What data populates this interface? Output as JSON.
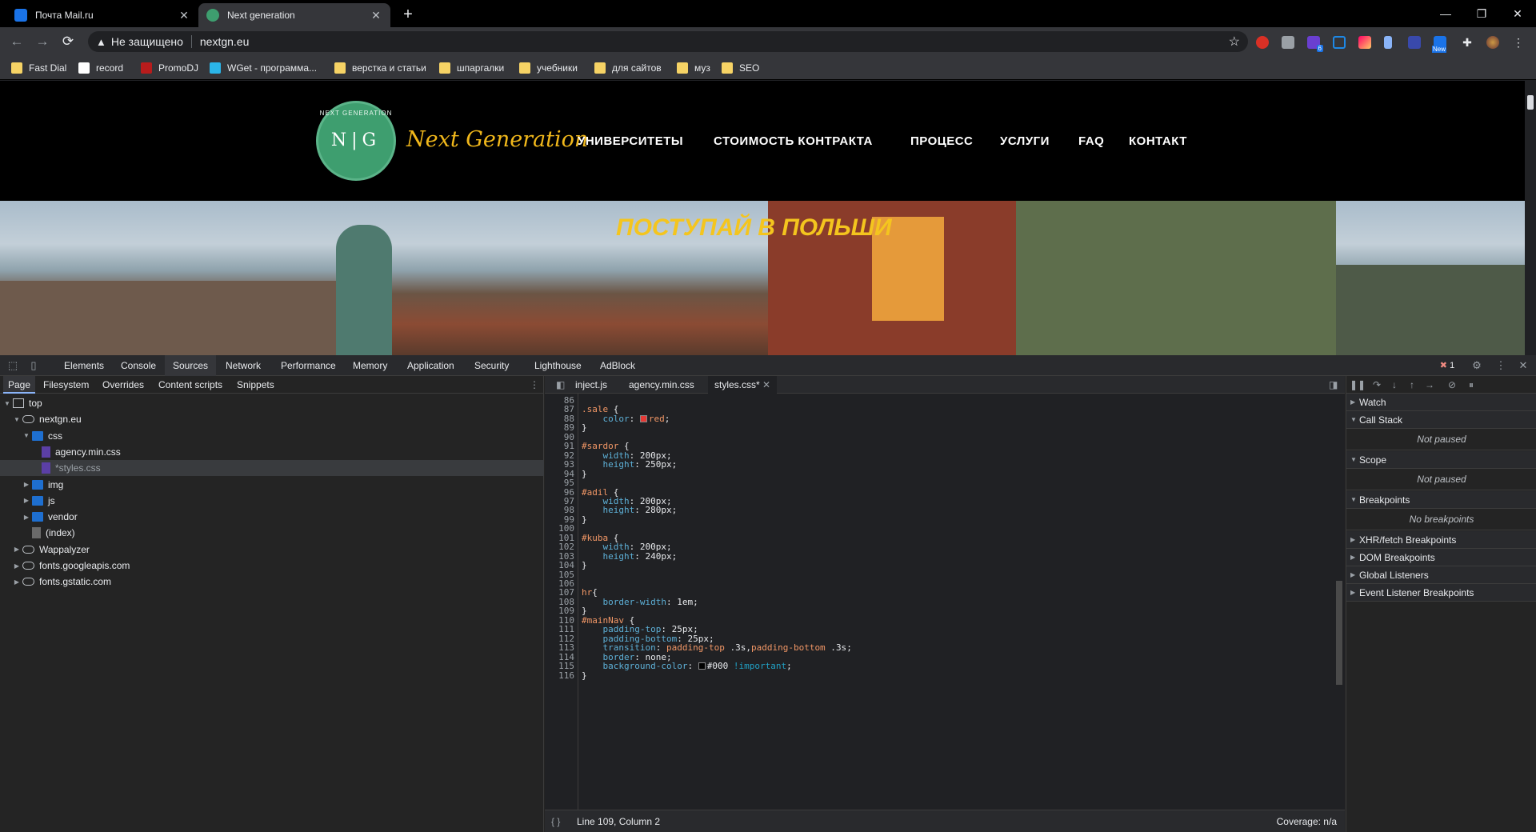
{
  "browser": {
    "tabs": [
      {
        "title": "Почта Mail.ru",
        "favicon_color": "#1a73e8"
      },
      {
        "title": "Next generation",
        "favicon_color": "#3e9e6f"
      }
    ],
    "address": {
      "security": "Не защищено",
      "url": "nextgn.eu"
    },
    "bookmarks": [
      {
        "label": "Fast Dial",
        "icon": "folder-icon"
      },
      {
        "label": "record",
        "icon": "record-icon"
      },
      {
        "label": "PromoDJ",
        "icon": "promodj-icon"
      },
      {
        "label": "WGet - программа...",
        "icon": "wget-icon"
      },
      {
        "label": "верстка и статьи",
        "icon": "folder-icon"
      },
      {
        "label": "шпаргалки",
        "icon": "folder-icon"
      },
      {
        "label": "учебники",
        "icon": "folder-icon"
      },
      {
        "label": "для сайтов",
        "icon": "folder-icon"
      },
      {
        "label": "муз",
        "icon": "folder-icon"
      },
      {
        "label": "SEO",
        "icon": "folder-icon"
      }
    ],
    "extension_badges": {
      "purple": "6",
      "new": "New"
    }
  },
  "site": {
    "logo_initials": "N|G",
    "logo_ring": "NEXT GENERATION",
    "brand": "Next Generation",
    "nav": [
      "УНИВЕРСИТЕТЫ",
      "СТОИМОСТЬ КОНТРАКТА",
      "ПРОЦЕСС",
      "УСЛУГИ",
      "FAQ",
      "КОНТАКТ"
    ],
    "hero_text": "ПОСТУПАЙ В ПОЛЬШИ"
  },
  "devtools": {
    "tabs": [
      "Elements",
      "Console",
      "Sources",
      "Network",
      "Performance",
      "Memory",
      "Application",
      "Security",
      "Lighthouse",
      "AdBlock"
    ],
    "active_tab": "Sources",
    "error_count": "1",
    "navigator_tabs": [
      "Page",
      "Filesystem",
      "Overrides",
      "Content scripts",
      "Snippets"
    ],
    "tree": [
      {
        "label": "top",
        "depth": 0,
        "icon": "frame-icon",
        "arrow": "▼"
      },
      {
        "label": "nextgn.eu",
        "depth": 1,
        "icon": "cloud-icon",
        "arrow": "▼"
      },
      {
        "label": "css",
        "depth": 2,
        "icon": "folder-icon",
        "arrow": "▼"
      },
      {
        "label": "agency.min.css",
        "depth": 3,
        "icon": "css-file-icon",
        "arrow": ""
      },
      {
        "label": "*styles.css",
        "depth": 3,
        "icon": "css-file-icon",
        "arrow": "",
        "selected": true
      },
      {
        "label": "img",
        "depth": 2,
        "icon": "folder-icon",
        "arrow": "▶"
      },
      {
        "label": "js",
        "depth": 2,
        "icon": "folder-icon",
        "arrow": "▶"
      },
      {
        "label": "vendor",
        "depth": 2,
        "icon": "folder-icon",
        "arrow": "▶"
      },
      {
        "label": "(index)",
        "depth": 2,
        "icon": "file-icon",
        "arrow": ""
      },
      {
        "label": "Wappalyzer",
        "depth": 1,
        "icon": "cloud-icon",
        "arrow": "▶"
      },
      {
        "label": "fonts.googleapis.com",
        "depth": 1,
        "icon": "cloud-icon",
        "arrow": "▶"
      },
      {
        "label": "fonts.gstatic.com",
        "depth": 1,
        "icon": "cloud-icon",
        "arrow": "▶"
      }
    ],
    "editor_tabs": [
      "inject.js",
      "agency.min.css",
      "styles.css*"
    ],
    "code_lines": [
      {
        "n": "86",
        "t": ""
      },
      {
        "n": "87",
        "t": ".sale {"
      },
      {
        "n": "88",
        "t": "    color: red;"
      },
      {
        "n": "89",
        "t": "}"
      },
      {
        "n": "90",
        "t": ""
      },
      {
        "n": "91",
        "t": "#sardor {"
      },
      {
        "n": "92",
        "t": "    width: 200px;"
      },
      {
        "n": "93",
        "t": "    height: 250px;"
      },
      {
        "n": "94",
        "t": "}"
      },
      {
        "n": "95",
        "t": ""
      },
      {
        "n": "96",
        "t": "#adil {"
      },
      {
        "n": "97",
        "t": "    width: 200px;"
      },
      {
        "n": "98",
        "t": "    height: 280px;"
      },
      {
        "n": "99",
        "t": "}"
      },
      {
        "n": "100",
        "t": ""
      },
      {
        "n": "101",
        "t": "#kuba {"
      },
      {
        "n": "102",
        "t": "    width: 200px;"
      },
      {
        "n": "103",
        "t": "    height: 240px;"
      },
      {
        "n": "104",
        "t": "}"
      },
      {
        "n": "105",
        "t": ""
      },
      {
        "n": "106",
        "t": ""
      },
      {
        "n": "107",
        "t": "hr{"
      },
      {
        "n": "108",
        "t": "    border-width: 1em;"
      },
      {
        "n": "109",
        "t": "}"
      },
      {
        "n": "110",
        "t": "#mainNav {"
      },
      {
        "n": "111",
        "t": "    padding-top: 25px;"
      },
      {
        "n": "112",
        "t": "    padding-bottom: 25px;"
      },
      {
        "n": "113",
        "t": "    transition: padding-top .3s,padding-bottom .3s;"
      },
      {
        "n": "114",
        "t": "    border: none;"
      },
      {
        "n": "115",
        "t": "    background-color: #000 !important;"
      },
      {
        "n": "116",
        "t": "}"
      }
    ],
    "status_left": "Line 109, Column 2",
    "status_right": "Coverage: n/a",
    "debugger": [
      {
        "label": "Watch",
        "open": false
      },
      {
        "label": "Call Stack",
        "open": true,
        "body": "Not paused"
      },
      {
        "label": "Scope",
        "open": true,
        "body": "Not paused"
      },
      {
        "label": "Breakpoints",
        "open": true,
        "body": "No breakpoints"
      },
      {
        "label": "XHR/fetch Breakpoints",
        "open": false
      },
      {
        "label": "DOM Breakpoints",
        "open": false
      },
      {
        "label": "Global Listeners",
        "open": false
      },
      {
        "label": "Event Listener Breakpoints",
        "open": false
      }
    ]
  }
}
